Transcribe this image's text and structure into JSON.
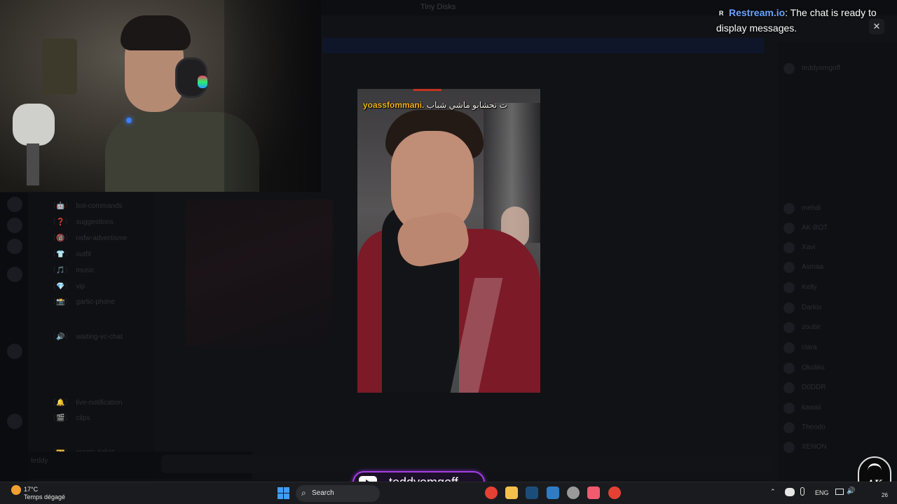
{
  "background_app": {
    "window_title": "Tiny Disks",
    "channels": [
      {
        "prefix": "〔🤖〕",
        "label": "bot-commands"
      },
      {
        "prefix": "〔❓〕",
        "label": "suggestions"
      },
      {
        "prefix": "〔🔞〕",
        "label": "nsfw-advertisme"
      },
      {
        "prefix": "〔👕〕",
        "label": "outfit"
      },
      {
        "prefix": "〔🎵〕",
        "label": "music"
      },
      {
        "prefix": "〔💎〕",
        "label": "vip"
      },
      {
        "prefix": "〔📸〕",
        "label": "gartic-phone"
      },
      {
        "prefix": "〔🔊〕",
        "label": "waiting-vc-chat"
      },
      {
        "prefix": "〔🔔〕",
        "label": "live-notification"
      },
      {
        "prefix": "〔🎬〕",
        "label": "clips"
      },
      {
        "prefix": "〔🎫〕",
        "label": "create-ticket"
      }
    ],
    "members": [
      {
        "name": "teddyomgoff"
      },
      {
        "name": "mehdi"
      },
      {
        "name": "AK-BOT"
      },
      {
        "name": "Xavi"
      },
      {
        "name": "Asmaa"
      },
      {
        "name": "Kelly"
      },
      {
        "name": "Darkix"
      },
      {
        "name": "zoubir"
      },
      {
        "name": "clara"
      },
      {
        "name": "Okoliks"
      },
      {
        "name": "D0DDR"
      },
      {
        "name": "kawaii"
      },
      {
        "name": "Theodo"
      },
      {
        "name": "XENON"
      }
    ],
    "user_panel_name": "teddy"
  },
  "video": {
    "caption_user": "yoassfommani.",
    "caption_text": "ت نحشابو ماشي شباب"
  },
  "notification": {
    "brand": "Restream.io",
    "message": ": The chat is ready to display messages.",
    "logo_glyph": "R",
    "close_glyph": "✕"
  },
  "channel_badge": {
    "platform_icon": "youtube-icon",
    "name": "teddyomgoff"
  },
  "overlay_logo": {
    "text": "AK"
  },
  "taskbar": {
    "weather_temp": "17°C",
    "weather_desc": "Temps dégagé",
    "search_label": "Search",
    "search_icon": "⌕",
    "apps": [
      {
        "name": "chrome-icon",
        "color": "#e44134"
      },
      {
        "name": "file-explorer-icon",
        "color": "#f2c14a"
      },
      {
        "name": "steam-icon",
        "color": "#1b4d7a"
      },
      {
        "name": "app-icon",
        "color": "#2f7cc4"
      },
      {
        "name": "settings-icon",
        "color": "#9a9a9a"
      },
      {
        "name": "music-icon",
        "color": "#f25a6f"
      },
      {
        "name": "chrome-icon-2",
        "color": "#e44134"
      }
    ],
    "tray_chevron": "⌃",
    "tray_lang": "ENG",
    "tray_volume": "🔊",
    "tray_clock": "26"
  },
  "colors": {
    "accent_purple": "#a53fe0",
    "restream_blue": "#6aa5ff",
    "caption_yellow": "#f4b21b",
    "hoodie_red": "#7c1a27"
  }
}
